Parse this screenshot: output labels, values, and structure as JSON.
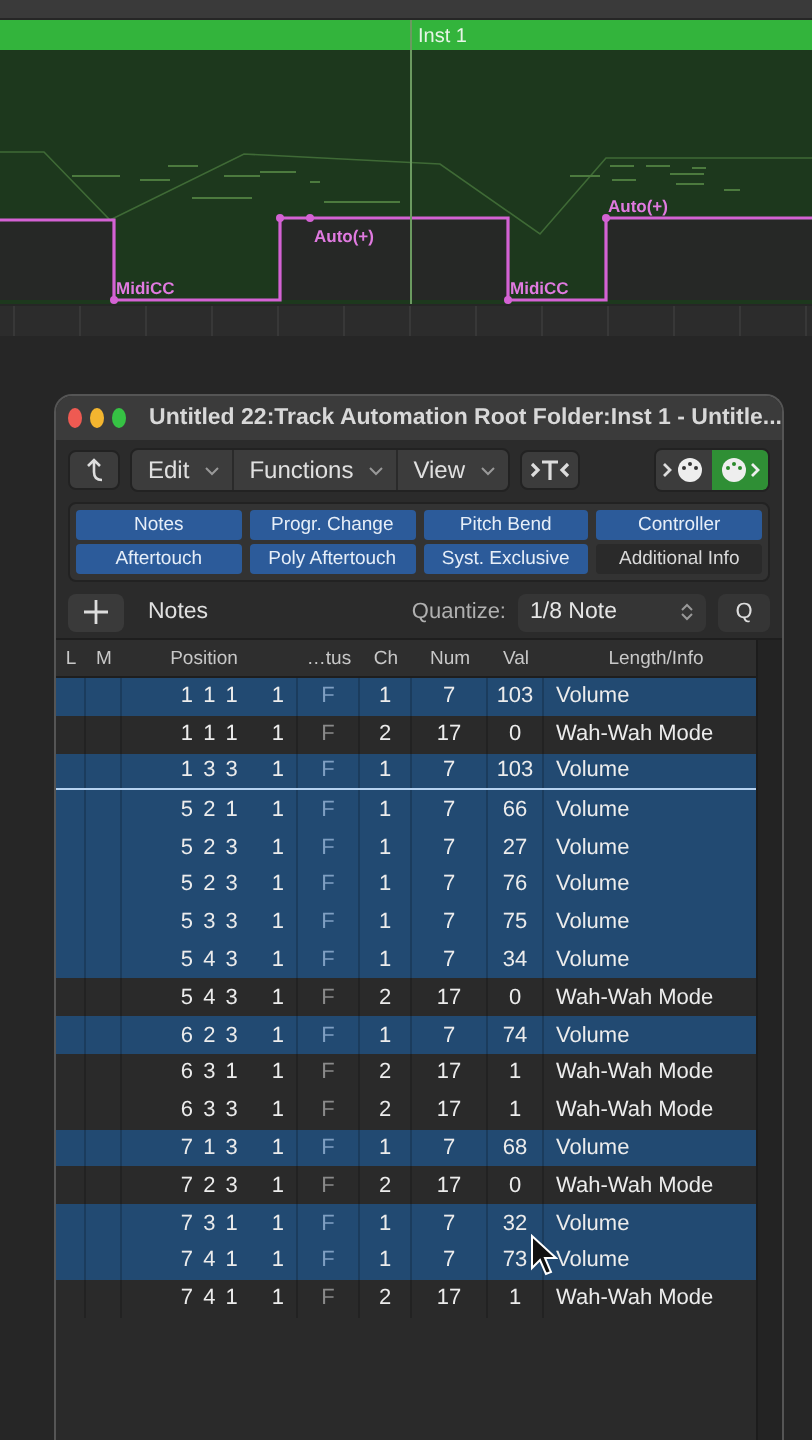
{
  "arrange": {
    "region_label": "Inst 1",
    "automation_labels": [
      {
        "text": "MidiCC",
        "kind": "low"
      },
      {
        "text": "Auto(+)",
        "kind": "high"
      },
      {
        "text": "MidiCC",
        "kind": "low"
      },
      {
        "text": "Auto(+)",
        "kind": "high"
      }
    ]
  },
  "window": {
    "title": "Untitled 22:Track Automation Root Folder:Inst 1 - Untitle..."
  },
  "menus": [
    "Edit",
    "Functions",
    "View"
  ],
  "filters": [
    {
      "label": "Notes",
      "on": true
    },
    {
      "label": "Progr. Change",
      "on": true
    },
    {
      "label": "Pitch Bend",
      "on": true
    },
    {
      "label": "Controller",
      "on": true
    },
    {
      "label": "Aftertouch",
      "on": true
    },
    {
      "label": "Poly Aftertouch",
      "on": true
    },
    {
      "label": "Syst. Exclusive",
      "on": true
    },
    {
      "label": "Additional Info",
      "on": false
    }
  ],
  "list_bar": {
    "type_label": "Notes",
    "quantize_label": "Quantize:",
    "quantize_value": "1/8 Note",
    "q_button": "Q"
  },
  "table": {
    "columns": [
      "L",
      "M",
      "Position",
      "…tus",
      "Ch",
      "Num",
      "Val",
      "Length/Info"
    ],
    "rows": [
      {
        "position": "1 1 1",
        "tick": "1",
        "status": "F",
        "ch": "1",
        "num": "7",
        "val": "103",
        "info": "Volume",
        "selected": true,
        "line_below": false
      },
      {
        "position": "1 1 1",
        "tick": "1",
        "status": "F",
        "ch": "2",
        "num": "17",
        "val": "0",
        "info": "Wah-Wah Mode",
        "selected": false,
        "line_below": false
      },
      {
        "position": "1 3 3",
        "tick": "1",
        "status": "F",
        "ch": "1",
        "num": "7",
        "val": "103",
        "info": "Volume",
        "selected": true,
        "line_below": true
      },
      {
        "position": "5 2 1",
        "tick": "1",
        "status": "F",
        "ch": "1",
        "num": "7",
        "val": "66",
        "info": "Volume",
        "selected": true,
        "line_below": false
      },
      {
        "position": "5 2 3",
        "tick": "1",
        "status": "F",
        "ch": "1",
        "num": "7",
        "val": "27",
        "info": "Volume",
        "selected": true,
        "line_below": false
      },
      {
        "position": "5 2 3",
        "tick": "1",
        "status": "F",
        "ch": "1",
        "num": "7",
        "val": "76",
        "info": "Volume",
        "selected": true,
        "line_below": false
      },
      {
        "position": "5 3 3",
        "tick": "1",
        "status": "F",
        "ch": "1",
        "num": "7",
        "val": "75",
        "info": "Volume",
        "selected": true,
        "line_below": false
      },
      {
        "position": "5 4 3",
        "tick": "1",
        "status": "F",
        "ch": "1",
        "num": "7",
        "val": "34",
        "info": "Volume",
        "selected": true,
        "line_below": false
      },
      {
        "position": "5 4 3",
        "tick": "1",
        "status": "F",
        "ch": "2",
        "num": "17",
        "val": "0",
        "info": "Wah-Wah Mode",
        "selected": false,
        "line_below": false
      },
      {
        "position": "6 2 3",
        "tick": "1",
        "status": "F",
        "ch": "1",
        "num": "7",
        "val": "74",
        "info": "Volume",
        "selected": true,
        "line_below": false
      },
      {
        "position": "6 3 1",
        "tick": "1",
        "status": "F",
        "ch": "2",
        "num": "17",
        "val": "1",
        "info": "Wah-Wah Mode",
        "selected": false,
        "line_below": false
      },
      {
        "position": "6 3 3",
        "tick": "1",
        "status": "F",
        "ch": "2",
        "num": "17",
        "val": "1",
        "info": "Wah-Wah Mode",
        "selected": false,
        "line_below": false
      },
      {
        "position": "7 1 3",
        "tick": "1",
        "status": "F",
        "ch": "1",
        "num": "7",
        "val": "68",
        "info": "Volume",
        "selected": true,
        "line_below": false
      },
      {
        "position": "7 2 3",
        "tick": "1",
        "status": "F",
        "ch": "2",
        "num": "17",
        "val": "0",
        "info": "Wah-Wah Mode",
        "selected": false,
        "line_below": false
      },
      {
        "position": "7 3 1",
        "tick": "1",
        "status": "F",
        "ch": "1",
        "num": "7",
        "val": "32",
        "info": "Volume",
        "selected": true,
        "line_below": false
      },
      {
        "position": "7 4 1",
        "tick": "1",
        "status": "F",
        "ch": "1",
        "num": "7",
        "val": "73",
        "info": "Volume",
        "selected": true,
        "line_below": false
      },
      {
        "position": "7 4 1",
        "tick": "1",
        "status": "F",
        "ch": "2",
        "num": "17",
        "val": "1",
        "info": "Wah-Wah Mode",
        "selected": false,
        "line_below": false
      }
    ]
  }
}
